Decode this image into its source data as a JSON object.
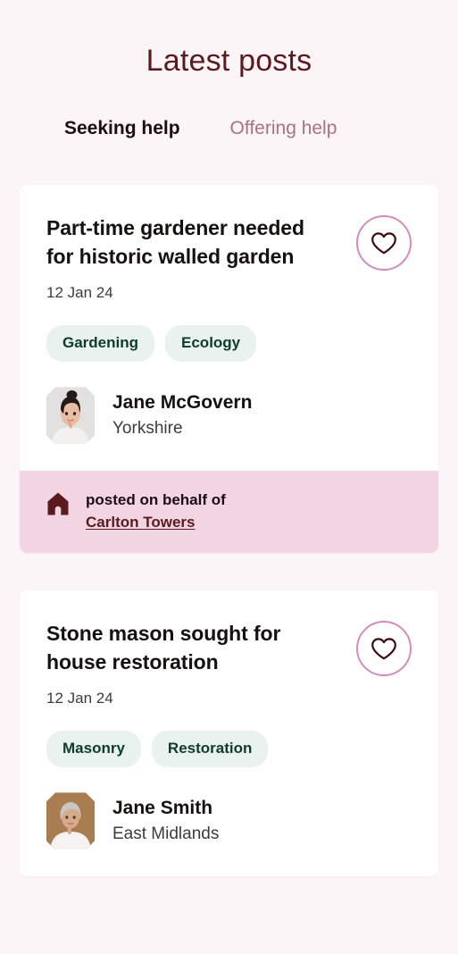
{
  "header": {
    "title": "Latest posts"
  },
  "tabs": [
    {
      "label": "Seeking help",
      "active": true
    },
    {
      "label": "Offering help",
      "active": false
    }
  ],
  "theme": {
    "page_background": "#FBF5F8",
    "title_color": "#5A1A1E",
    "tab_active_color": "#1B0D10",
    "tab_inactive_color": "#A9737E",
    "tab_underline_color": "#DD93C4",
    "card_background": "#FFFFFF",
    "tag_background": "#E9F2EE",
    "tag_color": "#0F3B2C",
    "favourite_border_color": "#D48CBB",
    "favourite_heart_color": "#3A0C10",
    "banner_background": "#F2D5E3",
    "banner_link_color": "#5A1A1E"
  },
  "posts": [
    {
      "title": "Part-time gardener needed for historic walled garden",
      "date": "12 Jan 24",
      "tags": [
        "Gardening",
        "Ecology"
      ],
      "favourite_icon": "heart-outline-icon",
      "author": {
        "name": "Jane McGovern",
        "location": "Yorkshire",
        "avatar_icon": "avatar-photo-jane-mcgovern"
      },
      "behalf": {
        "icon": "house-icon",
        "prefix": "posted on behalf of",
        "organisation": "Carlton Towers"
      }
    },
    {
      "title": "Stone mason sought for house restoration",
      "date": "12 Jan 24",
      "tags": [
        "Masonry",
        "Restoration"
      ],
      "favourite_icon": "heart-outline-icon",
      "author": {
        "name": "Jane Smith",
        "location": "East Midlands",
        "avatar_icon": "avatar-photo-jane-smith"
      },
      "behalf": null
    }
  ]
}
